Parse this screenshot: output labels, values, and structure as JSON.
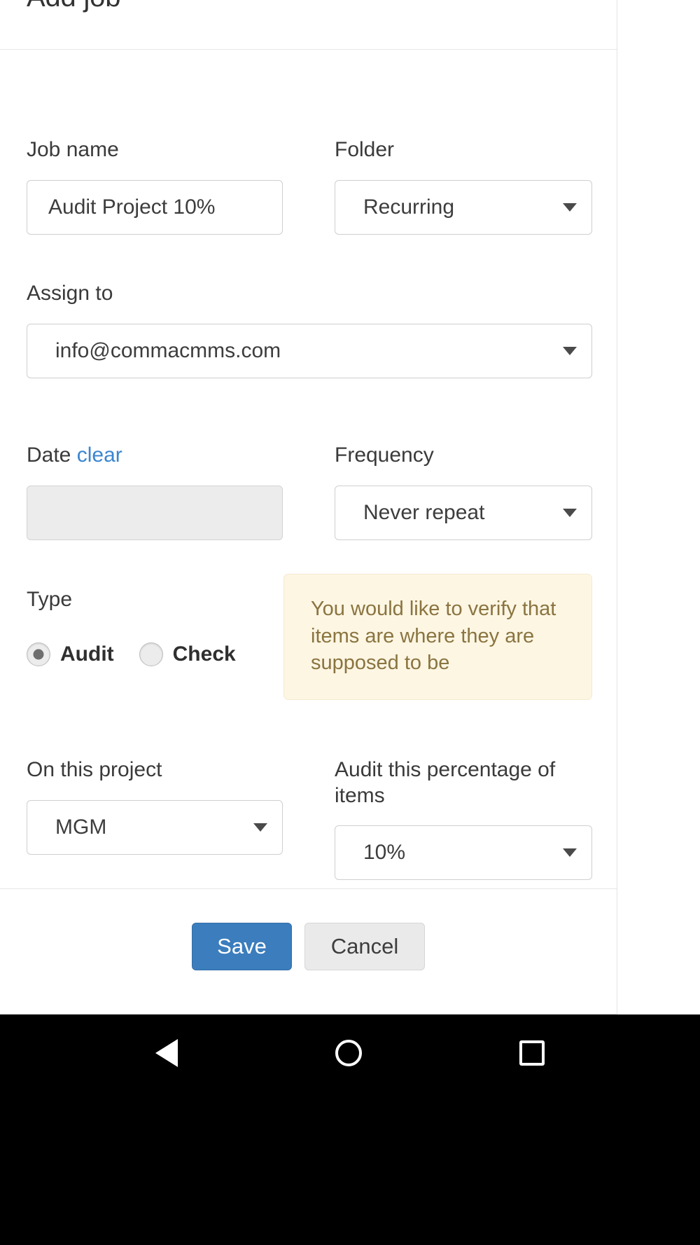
{
  "dialog": {
    "title": "Add job",
    "fields": {
      "job_name": {
        "label": "Job name",
        "value": "Audit Project 10%"
      },
      "folder": {
        "label": "Folder",
        "value": "Recurring"
      },
      "assign_to": {
        "label": "Assign to",
        "value": "info@commacmms.com"
      },
      "date": {
        "label": "Date",
        "clear_label": "clear",
        "value": ""
      },
      "frequency": {
        "label": "Frequency",
        "value": "Never repeat"
      },
      "type": {
        "label": "Type",
        "options": [
          {
            "label": "Audit",
            "selected": true
          },
          {
            "label": "Check",
            "selected": false
          }
        ]
      },
      "project": {
        "label": "On this project",
        "value": "MGM"
      },
      "percentage": {
        "label": "Audit this percentage of items",
        "value": "10%"
      }
    },
    "note": "You would like to verify that items are where they are supposed to be",
    "footer": {
      "save_label": "Save",
      "cancel_label": "Cancel"
    }
  },
  "navbar": {
    "back_label": "Back",
    "home_label": "Home",
    "recents_label": "Recent apps"
  },
  "colors": {
    "primary": "#3b7dbd",
    "link": "#3a86d0",
    "note_bg": "#fdf6e3",
    "note_text": "#8a7440",
    "navbar_bg": "#000000"
  }
}
